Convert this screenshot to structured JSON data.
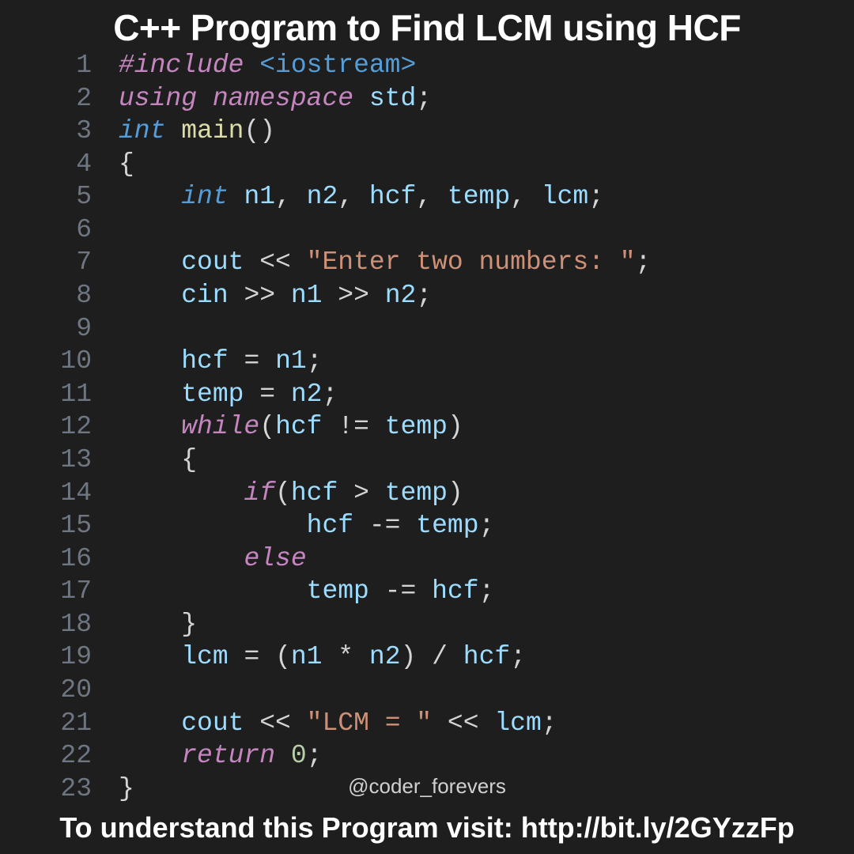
{
  "title": "C++ Program to Find LCM using HCF",
  "handle": "@coder_forevers",
  "footer": "To understand this Program visit: http://bit.ly/2GYzzFp",
  "colors": {
    "background": "#1e1e1e",
    "text": "#d4d4d4",
    "lineno": "#6e7681",
    "keyword_pp": "#c586c0",
    "keyword_type": "#569cd6",
    "keyword_ctrl": "#c586c0",
    "identifier": "#9cdcfe",
    "function": "#dcdcaa",
    "string": "#ce9178",
    "number": "#b5cea8"
  },
  "code": {
    "lines": [
      {
        "n": "1",
        "tokens": [
          [
            "kw-pp",
            "#include"
          ],
          [
            "punct",
            " "
          ],
          [
            "angle",
            "<iostream>"
          ]
        ]
      },
      {
        "n": "2",
        "tokens": [
          [
            "kw-ns",
            "using namespace"
          ],
          [
            "punct",
            " "
          ],
          [
            "ident",
            "std"
          ],
          [
            "punct",
            ";"
          ]
        ]
      },
      {
        "n": "3",
        "tokens": [
          [
            "kw-type",
            "int"
          ],
          [
            "punct",
            " "
          ],
          [
            "func",
            "main"
          ],
          [
            "punct",
            "()"
          ]
        ]
      },
      {
        "n": "4",
        "tokens": [
          [
            "punct",
            "{"
          ]
        ]
      },
      {
        "n": "5",
        "tokens": [
          [
            "punct",
            "    "
          ],
          [
            "kw-type",
            "int"
          ],
          [
            "punct",
            " "
          ],
          [
            "ident",
            "n1"
          ],
          [
            "punct",
            ", "
          ],
          [
            "ident",
            "n2"
          ],
          [
            "punct",
            ", "
          ],
          [
            "ident",
            "hcf"
          ],
          [
            "punct",
            ", "
          ],
          [
            "ident",
            "temp"
          ],
          [
            "punct",
            ", "
          ],
          [
            "ident",
            "lcm"
          ],
          [
            "punct",
            ";"
          ]
        ]
      },
      {
        "n": "6",
        "tokens": []
      },
      {
        "n": "7",
        "tokens": [
          [
            "punct",
            "    "
          ],
          [
            "ident",
            "cout"
          ],
          [
            "punct",
            " "
          ],
          [
            "op",
            "<<"
          ],
          [
            "punct",
            " "
          ],
          [
            "str",
            "\"Enter two numbers: \""
          ],
          [
            "punct",
            ";"
          ]
        ]
      },
      {
        "n": "8",
        "tokens": [
          [
            "punct",
            "    "
          ],
          [
            "ident",
            "cin"
          ],
          [
            "punct",
            " "
          ],
          [
            "op",
            ">>"
          ],
          [
            "punct",
            " "
          ],
          [
            "ident",
            "n1"
          ],
          [
            "punct",
            " "
          ],
          [
            "op",
            ">>"
          ],
          [
            "punct",
            " "
          ],
          [
            "ident",
            "n2"
          ],
          [
            "punct",
            ";"
          ]
        ]
      },
      {
        "n": "9",
        "tokens": []
      },
      {
        "n": "10",
        "tokens": [
          [
            "punct",
            "    "
          ],
          [
            "ident",
            "hcf"
          ],
          [
            "punct",
            " "
          ],
          [
            "op",
            "="
          ],
          [
            "punct",
            " "
          ],
          [
            "ident",
            "n1"
          ],
          [
            "punct",
            ";"
          ]
        ]
      },
      {
        "n": "11",
        "tokens": [
          [
            "punct",
            "    "
          ],
          [
            "ident",
            "temp"
          ],
          [
            "punct",
            " "
          ],
          [
            "op",
            "="
          ],
          [
            "punct",
            " "
          ],
          [
            "ident",
            "n2"
          ],
          [
            "punct",
            ";"
          ]
        ]
      },
      {
        "n": "12",
        "tokens": [
          [
            "punct",
            "    "
          ],
          [
            "kw-ctrl",
            "while"
          ],
          [
            "punct",
            "("
          ],
          [
            "ident",
            "hcf"
          ],
          [
            "punct",
            " "
          ],
          [
            "op",
            "!="
          ],
          [
            "punct",
            " "
          ],
          [
            "ident",
            "temp"
          ],
          [
            "punct",
            ")"
          ]
        ]
      },
      {
        "n": "13",
        "tokens": [
          [
            "punct",
            "    {"
          ]
        ]
      },
      {
        "n": "14",
        "tokens": [
          [
            "punct",
            "        "
          ],
          [
            "kw-ctrl",
            "if"
          ],
          [
            "punct",
            "("
          ],
          [
            "ident",
            "hcf"
          ],
          [
            "punct",
            " "
          ],
          [
            "op",
            ">"
          ],
          [
            "punct",
            " "
          ],
          [
            "ident",
            "temp"
          ],
          [
            "punct",
            ")"
          ]
        ]
      },
      {
        "n": "15",
        "tokens": [
          [
            "punct",
            "            "
          ],
          [
            "ident",
            "hcf"
          ],
          [
            "punct",
            " "
          ],
          [
            "op",
            "-="
          ],
          [
            "punct",
            " "
          ],
          [
            "ident",
            "temp"
          ],
          [
            "punct",
            ";"
          ]
        ]
      },
      {
        "n": "16",
        "tokens": [
          [
            "punct",
            "        "
          ],
          [
            "kw-ctrl",
            "else"
          ]
        ]
      },
      {
        "n": "17",
        "tokens": [
          [
            "punct",
            "            "
          ],
          [
            "ident",
            "temp"
          ],
          [
            "punct",
            " "
          ],
          [
            "op",
            "-="
          ],
          [
            "punct",
            " "
          ],
          [
            "ident",
            "hcf"
          ],
          [
            "punct",
            ";"
          ]
        ]
      },
      {
        "n": "18",
        "tokens": [
          [
            "punct",
            "    }"
          ]
        ]
      },
      {
        "n": "19",
        "tokens": [
          [
            "punct",
            "    "
          ],
          [
            "ident",
            "lcm"
          ],
          [
            "punct",
            " "
          ],
          [
            "op",
            "="
          ],
          [
            "punct",
            " ("
          ],
          [
            "ident",
            "n1"
          ],
          [
            "punct",
            " "
          ],
          [
            "op",
            "*"
          ],
          [
            "punct",
            " "
          ],
          [
            "ident",
            "n2"
          ],
          [
            "punct",
            ") "
          ],
          [
            "op",
            "/"
          ],
          [
            "punct",
            " "
          ],
          [
            "ident",
            "hcf"
          ],
          [
            "punct",
            ";"
          ]
        ]
      },
      {
        "n": "20",
        "tokens": []
      },
      {
        "n": "21",
        "tokens": [
          [
            "punct",
            "    "
          ],
          [
            "ident",
            "cout"
          ],
          [
            "punct",
            " "
          ],
          [
            "op",
            "<<"
          ],
          [
            "punct",
            " "
          ],
          [
            "str",
            "\"LCM = \""
          ],
          [
            "punct",
            " "
          ],
          [
            "op",
            "<<"
          ],
          [
            "punct",
            " "
          ],
          [
            "ident",
            "lcm"
          ],
          [
            "punct",
            ";"
          ]
        ]
      },
      {
        "n": "22",
        "tokens": [
          [
            "punct",
            "    "
          ],
          [
            "kw-ret",
            "return"
          ],
          [
            "punct",
            " "
          ],
          [
            "num",
            "0"
          ],
          [
            "punct",
            ";"
          ]
        ]
      },
      {
        "n": "23",
        "tokens": [
          [
            "punct",
            "}"
          ]
        ]
      }
    ]
  }
}
